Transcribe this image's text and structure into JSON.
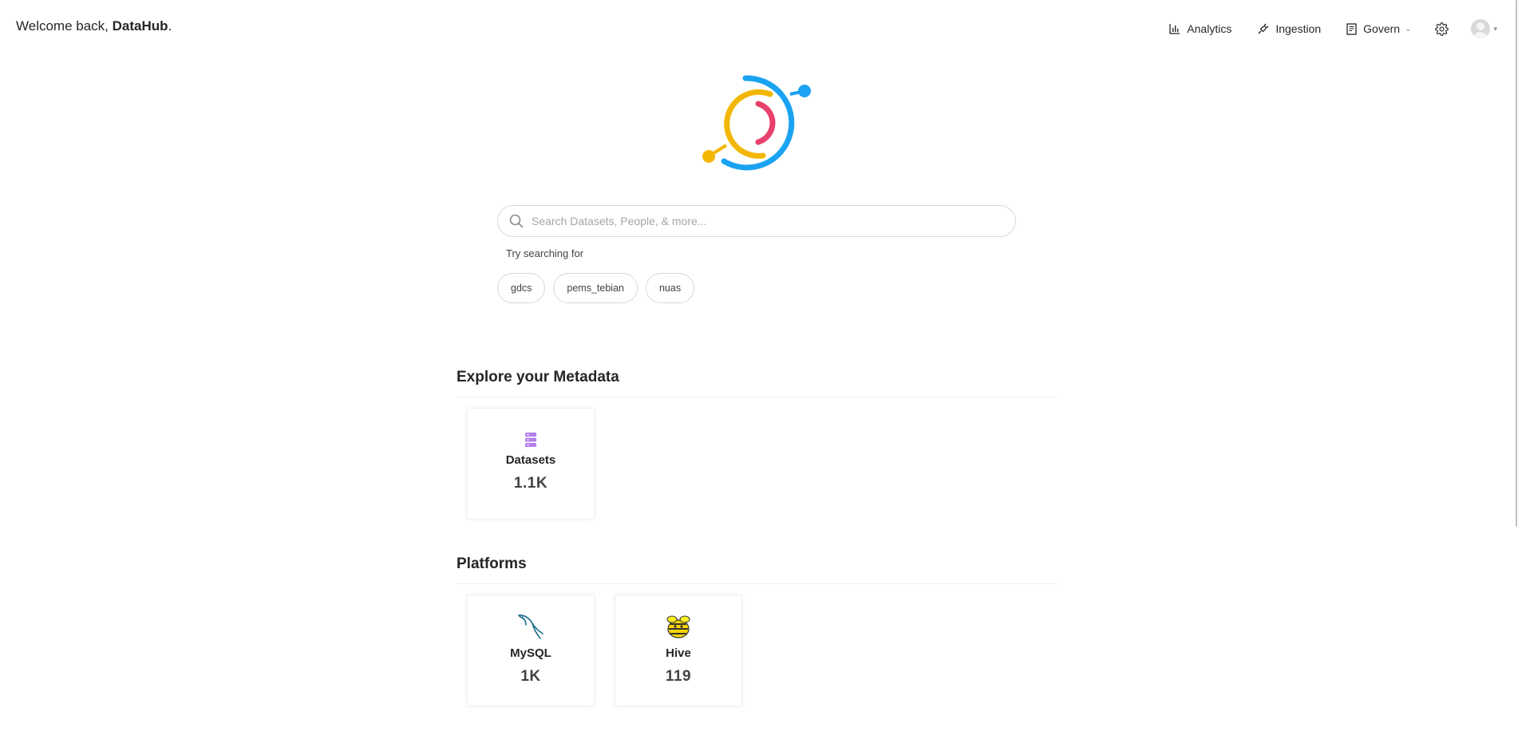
{
  "header": {
    "welcome_prefix": "Welcome back, ",
    "welcome_name": "DataHub",
    "welcome_suffix": ".",
    "nav": {
      "analytics": "Analytics",
      "ingestion": "Ingestion",
      "govern": "Govern"
    }
  },
  "search": {
    "placeholder": "Search Datasets, People, & more...",
    "try_label": "Try searching for",
    "suggestions": [
      "gdcs",
      "pems_tebian",
      "nuas"
    ]
  },
  "explore": {
    "title": "Explore your Metadata",
    "cards": [
      {
        "label": "Datasets",
        "count": "1.1K",
        "icon": "dataset-icon"
      }
    ]
  },
  "platforms": {
    "title": "Platforms",
    "cards": [
      {
        "label": "MySQL",
        "count": "1K",
        "icon": "mysql-dolphin-icon"
      },
      {
        "label": "Hive",
        "count": "119",
        "icon": "hive-bee-icon"
      }
    ]
  },
  "colors": {
    "accent_blue": "#1aa3f2",
    "accent_yellow": "#f2b705",
    "accent_pink": "#e8416b",
    "dataset_purple": "#b37feb"
  }
}
